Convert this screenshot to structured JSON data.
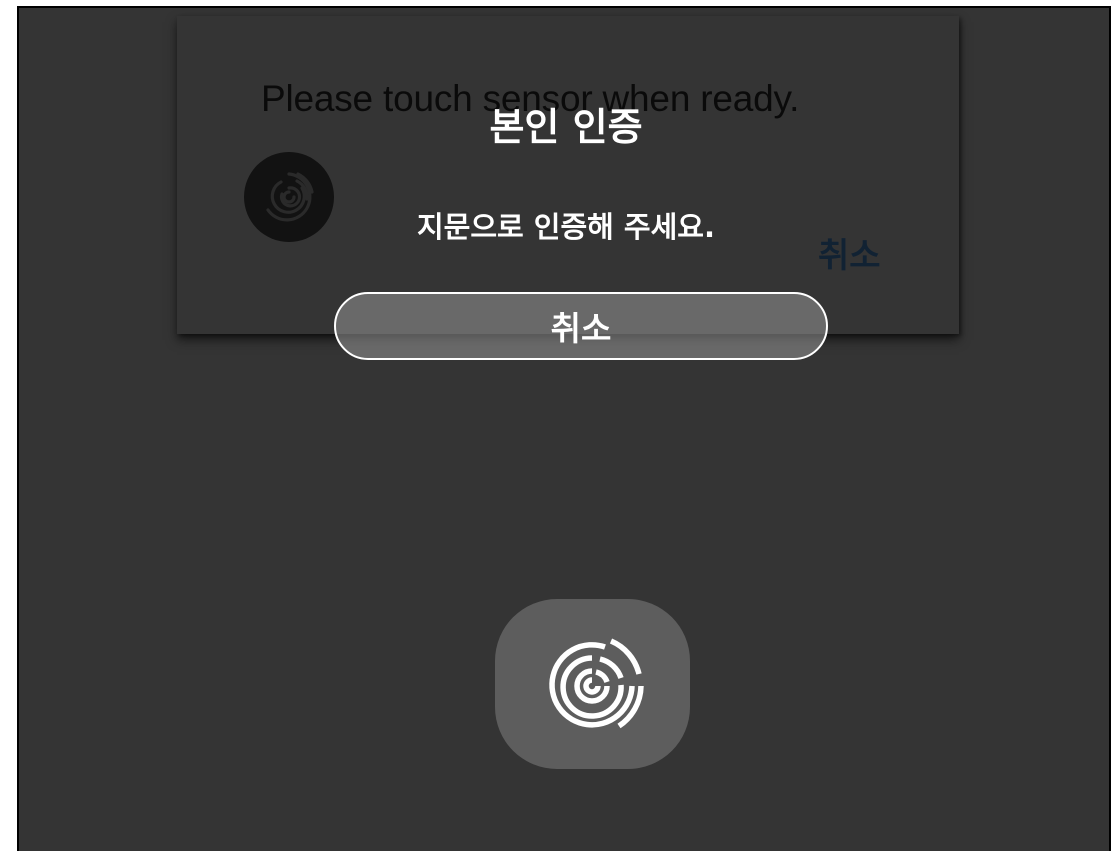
{
  "background_dialog": {
    "message": "Please touch sensor when ready.",
    "cancel_label": "취소",
    "icon": "fingerprint-icon"
  },
  "overlay": {
    "title": "본인 인증",
    "subtitle": "지문으로 인증해 주세요.",
    "cancel_label": "취소"
  },
  "sensor": {
    "icon": "fingerprint-icon"
  },
  "colors": {
    "screen_bg": "#343434",
    "sensor_bg": "#5d5d5d",
    "text_on_overlay": "#ffffff",
    "bg_cancel_text": "#112233"
  }
}
